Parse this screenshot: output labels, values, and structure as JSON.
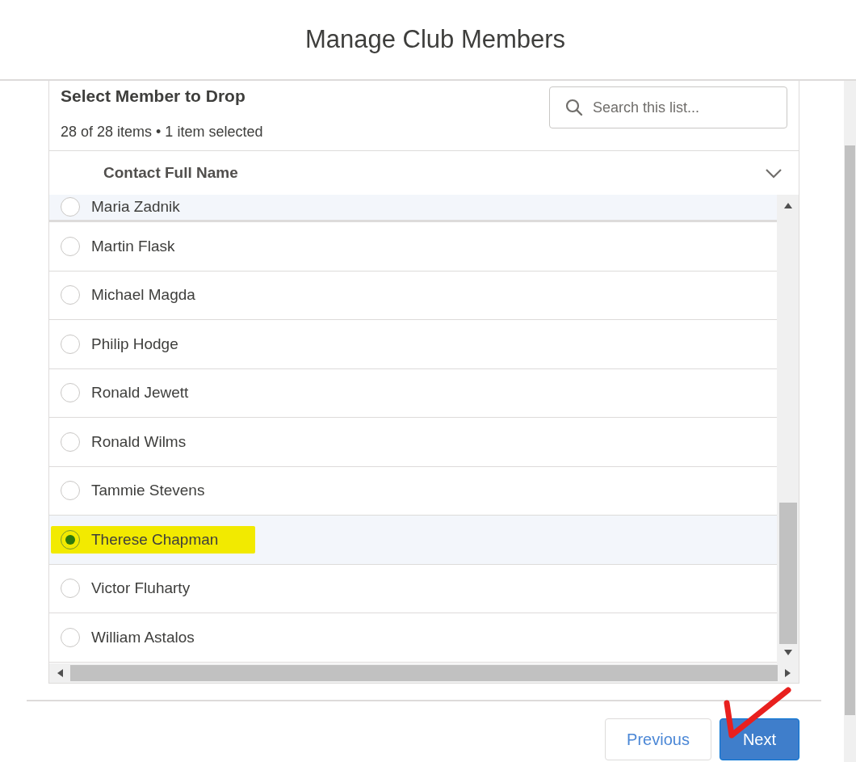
{
  "dialog": {
    "title": "Manage Club Members"
  },
  "list": {
    "title": "Select Member to Drop",
    "summary": "28 of 28 items • 1 item selected",
    "search": {
      "placeholder": "Search this list..."
    },
    "column": "Contact Full Name",
    "rows": [
      {
        "name": "Maria Zadnik",
        "kind": "partial",
        "selected": false,
        "highlighted": false
      },
      {
        "name": "Martin Flask",
        "kind": "full",
        "selected": false,
        "highlighted": false
      },
      {
        "name": "Michael Magda",
        "kind": "full",
        "selected": false,
        "highlighted": false
      },
      {
        "name": "Philip Hodge",
        "kind": "full",
        "selected": false,
        "highlighted": false
      },
      {
        "name": "Ronald Jewett",
        "kind": "full",
        "selected": false,
        "highlighted": false
      },
      {
        "name": "Ronald Wilms",
        "kind": "full",
        "selected": false,
        "highlighted": false
      },
      {
        "name": "Tammie Stevens",
        "kind": "full",
        "selected": false,
        "highlighted": false
      },
      {
        "name": "Therese Chapman",
        "kind": "full",
        "selected": true,
        "highlighted": true
      },
      {
        "name": "Victor Fluharty",
        "kind": "full",
        "selected": false,
        "highlighted": false
      },
      {
        "name": "William Astalos",
        "kind": "full",
        "selected": false,
        "highlighted": false
      }
    ]
  },
  "buttons": [
    {
      "label": "Previous",
      "kind": "neutral",
      "annotated": false
    },
    {
      "label": "Next",
      "kind": "brand",
      "annotated": true
    }
  ]
}
